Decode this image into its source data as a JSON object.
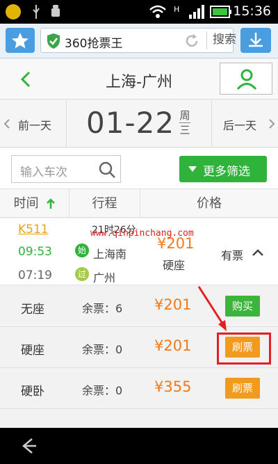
{
  "status_bar": {
    "time": "15:36"
  },
  "browser": {
    "site_title": "360抢票王",
    "search_label": "搜索"
  },
  "header": {
    "title": "上海-广州"
  },
  "date_bar": {
    "prev_day": "前一天",
    "date": "01-22",
    "weekday_top": "周",
    "weekday_bottom": "三",
    "next_day": "后一天"
  },
  "filter": {
    "train_no_placeholder": "输入车次",
    "more_filters": "更多筛选"
  },
  "table_header": {
    "time": "时间",
    "route": "行程",
    "price": "价格"
  },
  "train": {
    "number": "K511",
    "duration": "21时26分",
    "depart_time": "09:53",
    "arrive_time": "07:19",
    "start_tag": "始",
    "pass_tag": "过",
    "from_station": "上海南",
    "to_station": "广州",
    "price": "¥201",
    "seat": "硬座",
    "availability": "有票"
  },
  "seats": [
    {
      "seat": "无座",
      "remaining": "余票：6",
      "price": "¥201",
      "action": "购买",
      "action_color": "#3db43c"
    },
    {
      "seat": "硬座",
      "remaining": "余票：0",
      "price": "¥201",
      "action": "刷票",
      "action_color": "#f29a1d"
    },
    {
      "seat": "硬卧",
      "remaining": "余票：0",
      "price": "¥355",
      "action": "刷票",
      "action_color": "#f29a1d"
    }
  ],
  "watermark": "www.qinpinchang.com",
  "colors": {
    "accent_green": "#2fb33b",
    "price_orange": "#f07a1a",
    "highlight_red": "#e22020",
    "browser_blue": "#4a9ee0"
  }
}
